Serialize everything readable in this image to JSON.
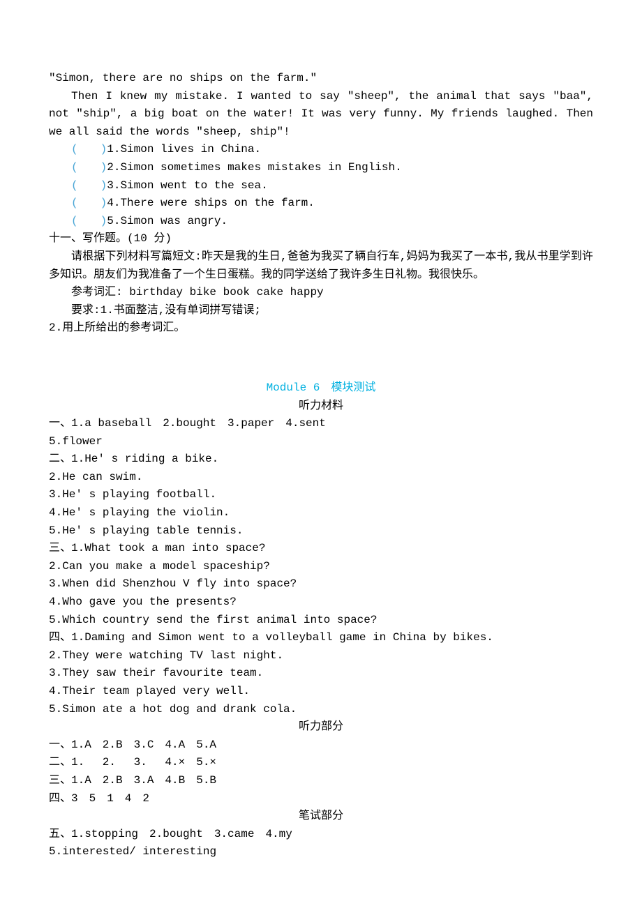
{
  "passage": {
    "l1": "\"Simon, there are no ships on the farm.\"",
    "l2": "Then I knew my mistake. I wanted to say \"sheep\", the animal that says \"baa\", not \"ship\", a big boat on the water! It was very funny. My friends laughed. Then we all said the words \"sheep, ship\"!"
  },
  "tf_questions": {
    "open": "(",
    "close": ")",
    "items": [
      "1.Simon lives in China.",
      "2.Simon sometimes makes mistakes in English.",
      "3.Simon went to the sea.",
      "4.There were ships on the farm.",
      "5.Simon was angry."
    ]
  },
  "section11": {
    "heading": "十一、写作题。(10 分)",
    "prompt": "请根据下列材料写篇短文:昨天是我的生日,爸爸为我买了辆自行车,妈妈为我买了一本书,我从书里学到许多知识。朋友们为我准备了一个生日蛋糕。我的同学送给了我许多生日礼物。我很快乐。",
    "vocab_label": "参考词汇: birthday bike book cake happy",
    "req_label": "要求:1.书面整洁,没有单词拼写错误;",
    "req2": "2.用上所给出的参考词汇。"
  },
  "answers": {
    "title": "Module 6　模块测试",
    "sub1": "听力材料",
    "sec1": [
      "一、1.a baseball　2.bought　3.paper　4.sent",
      "5.flower",
      "二、1.He' s riding a bike.",
      "2.He can swim.",
      "3.He' s playing football.",
      "4.He' s playing the violin.",
      "5.He' s playing table tennis.",
      "三、1.What took a man into space?",
      "2.Can you make a model spaceship?",
      "3.When did Shenzhou V fly into space?",
      "4.Who gave you the presents?",
      "5.Which country send the first animal into space?",
      "四、1.Daming and Simon went to a volleyball game in China by bikes.",
      "2.They were watching TV last night.",
      "3.They saw their favourite team.",
      "4.Their team played very well.",
      "5.Simon ate a hot dog and drank cola."
    ],
    "sub2": "听力部分",
    "sec2": [
      "一、1.A　2.B　3.C　4.A　5.A",
      "二、1.　 2.　 3.　 4.×　5.×",
      "三、1.A　2.B　3.A　4.B　5.B",
      "四、3　5　1　4　2"
    ],
    "sub3": "笔试部分",
    "sec3": [
      "五、1.stopping　2.bought　3.came　4.my",
      "5.interested/ interesting"
    ]
  }
}
